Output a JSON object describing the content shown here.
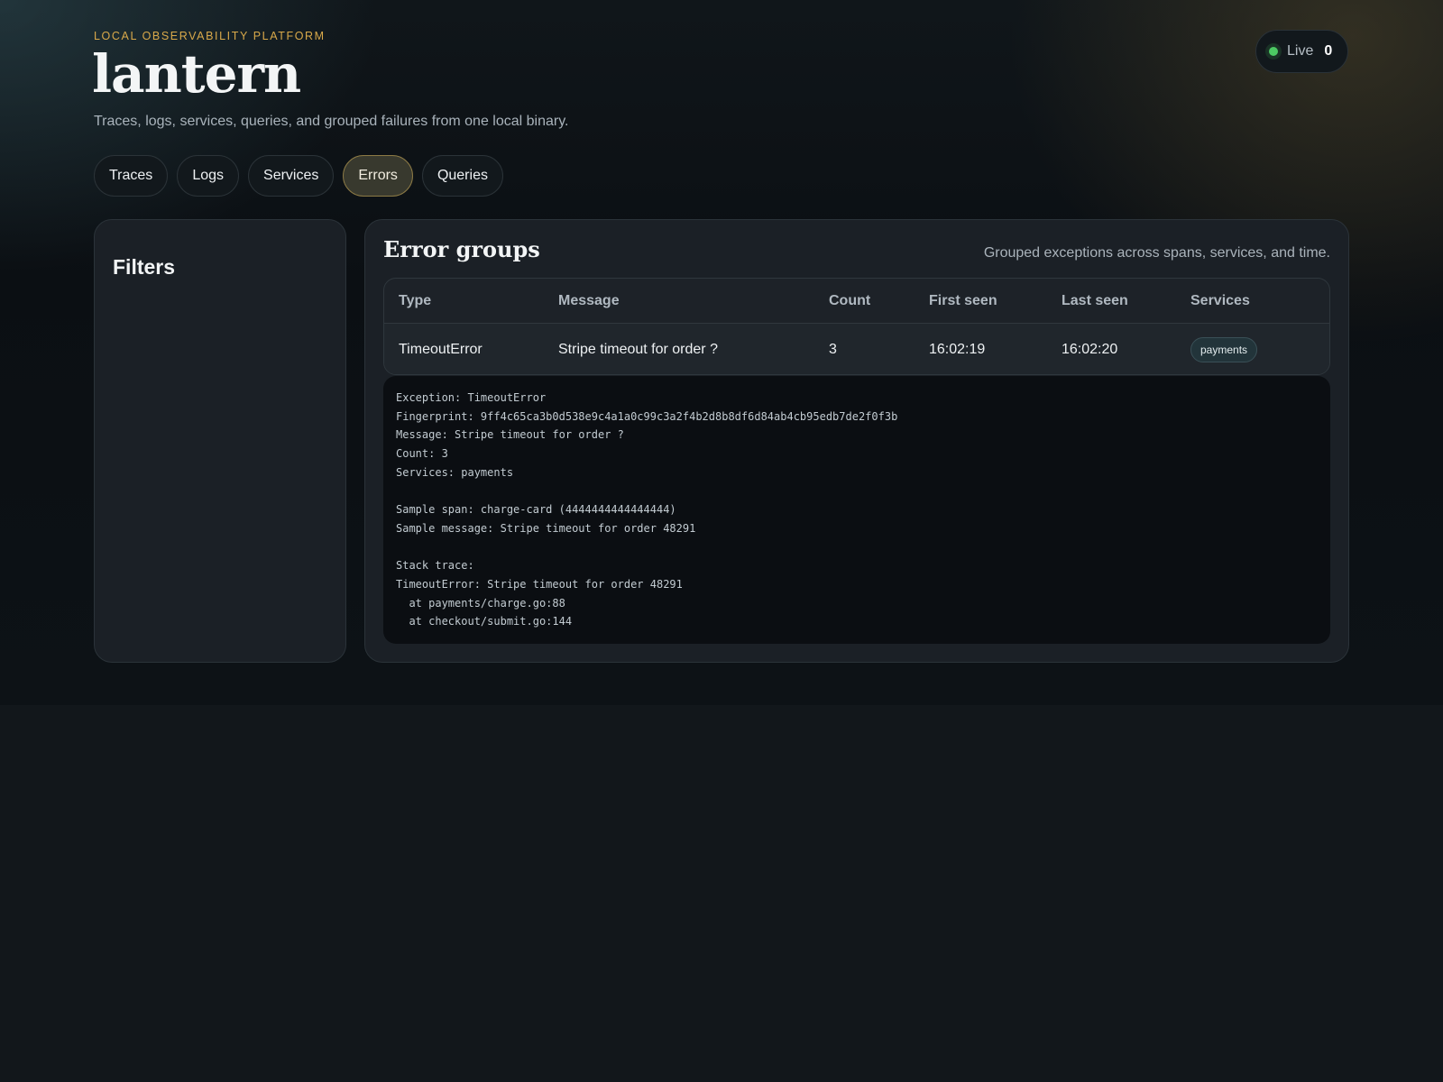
{
  "header": {
    "eyebrow": "LOCAL OBSERVABILITY PLATFORM",
    "brand": "lantern",
    "tagline": "Traces, logs, services, queries, and grouped failures from one local binary."
  },
  "live": {
    "label": "Live",
    "count": "0",
    "status_color": "#4cc963"
  },
  "tabs": [
    {
      "label": "Traces",
      "active": false
    },
    {
      "label": "Logs",
      "active": false
    },
    {
      "label": "Services",
      "active": false
    },
    {
      "label": "Errors",
      "active": true
    },
    {
      "label": "Queries",
      "active": false
    }
  ],
  "filters": {
    "title": "Filters"
  },
  "error_groups": {
    "title": "Error groups",
    "subtitle": "Grouped exceptions across spans, services, and time.",
    "columns": [
      "Type",
      "Message",
      "Count",
      "First seen",
      "Last seen",
      "Services"
    ],
    "rows": [
      {
        "type": "TimeoutError",
        "message": "Stripe timeout for order ?",
        "count": "3",
        "first_seen": "16:02:19",
        "last_seen": "16:02:20",
        "services": "payments"
      }
    ]
  },
  "detail": {
    "lines": [
      "Exception: TimeoutError",
      "Fingerprint: 9ff4c65ca3b0d538e9c4a1a0c99c3a2f4b2d8b8df6d84ab4cb95edb7de2f0f3b",
      "Message: Stripe timeout for order ?",
      "Count: 3",
      "Services: payments",
      "",
      "Sample span: charge-card (4444444444444444)",
      "Sample message: Stripe timeout for order 48291",
      "",
      "Stack trace:",
      "TimeoutError: Stripe timeout for order 48291",
      "  at payments/charge.go:88",
      "  at checkout/submit.go:144"
    ]
  },
  "colors": {
    "accent_gold": "#d9a94a",
    "active_tab_border": "#8c7a45",
    "panel_bg": "#1b2026",
    "code_bg": "#0b0e12"
  }
}
